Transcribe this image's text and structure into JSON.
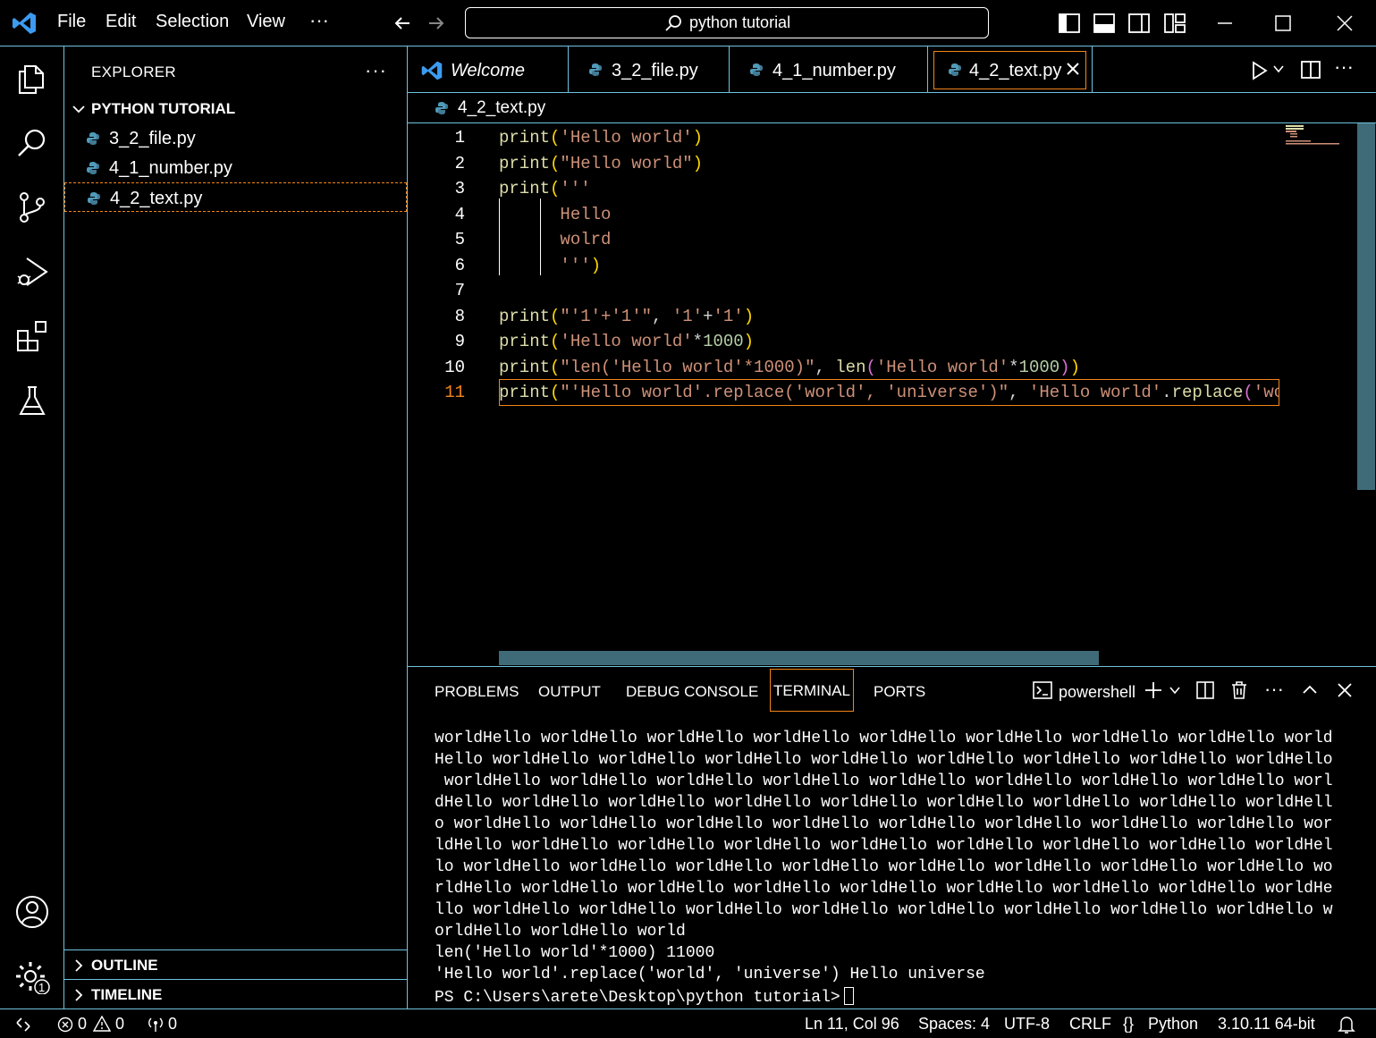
{
  "titlebar": {
    "menu": [
      "File",
      "Edit",
      "Selection",
      "View",
      "···"
    ],
    "search_text": "python tutorial"
  },
  "sidebar": {
    "title": "EXPLORER",
    "more": "···",
    "folder": "PYTHON TUTORIAL",
    "files": [
      "3_2_file.py",
      "4_1_number.py",
      "4_2_text.py"
    ],
    "sections": [
      "OUTLINE",
      "TIMELINE"
    ]
  },
  "tabs": [
    "Welcome",
    "3_2_file.py",
    "4_1_number.py",
    "4_2_text.py"
  ],
  "breadcrumb": "4_2_text.py",
  "editor": {
    "line_numbers": [
      "1",
      "2",
      "3",
      "4",
      "5",
      "6",
      "7",
      "8",
      "9",
      "10",
      "11"
    ],
    "current_line": "11"
  },
  "panel": {
    "tabs": [
      "PROBLEMS",
      "OUTPUT",
      "DEBUG CONSOLE",
      "TERMINAL",
      "PORTS"
    ],
    "shell": "powershell",
    "terminal_lines": [
      "worldHello worldHello worldHello worldHello worldHello worldHello worldHello worldHello world",
      "Hello worldHello worldHello worldHello worldHello worldHello worldHello worldHello worldHello",
      " worldHello worldHello worldHello worldHello worldHello worldHello worldHello worldHello worl",
      "dHello worldHello worldHello worldHello worldHello worldHello worldHello worldHello worldHell",
      "o worldHello worldHello worldHello worldHello worldHello worldHello worldHello worldHello wor",
      "ldHello worldHello worldHello worldHello worldHello worldHello worldHello worldHello worldHel",
      "lo worldHello worldHello worldHello worldHello worldHello worldHello worldHello worldHello wo",
      "rldHello worldHello worldHello worldHello worldHello worldHello worldHello worldHello worldHe",
      "llo worldHello worldHello worldHello worldHello worldHello worldHello worldHello worldHello w",
      "orldHello worldHello world",
      "len('Hello world'*1000) 11000",
      "'Hello world'.replace('world', 'universe') Hello universe"
    ],
    "prompt": "PS C:\\Users\\arete\\Desktop\\python tutorial>"
  },
  "statusbar": {
    "errors": "0",
    "warnings": "0",
    "ports": "0",
    "position": "Ln 11, Col 96",
    "spaces": "Spaces: 4",
    "encoding": "UTF-8",
    "eol": "CRLF",
    "language": "Python",
    "interpreter": "3.10.11 64-bit",
    "settings_badge": "1"
  },
  "colors": {
    "border": "#6fc3df",
    "focus": "#f38518",
    "function": "#dcdcaa",
    "string": "#ce9178",
    "number": "#b5cea8"
  }
}
